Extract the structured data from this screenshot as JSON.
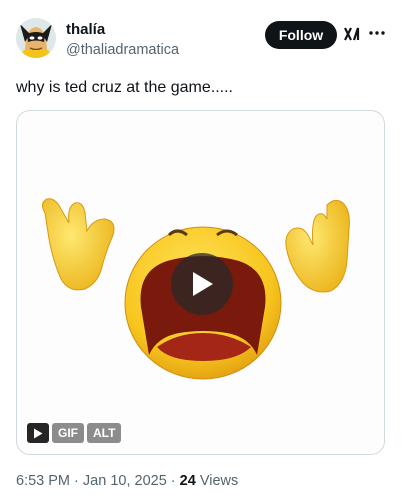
{
  "user": {
    "display_name": "thalía",
    "handle": "@thaliadramatica",
    "avatar_icon": "wolverine-avatar"
  },
  "header": {
    "follow_label": "Follow",
    "grok_icon": "grok-icon",
    "more_icon": "more-icon"
  },
  "tweet": {
    "text": "why is ted cruz at the game....."
  },
  "media": {
    "type": "gif",
    "badges": {
      "gif": "GIF",
      "alt": "ALT"
    },
    "play_icon": "play-icon"
  },
  "meta": {
    "time": "6:53 PM",
    "separator1": "·",
    "date": "Jan 10, 2025",
    "separator2": "·",
    "views_count": "24",
    "views_label": "Views"
  },
  "colors": {
    "text": "#0f1419",
    "secondary": "#536471",
    "border": "#cfd9de",
    "emoji_yellow": "#f7c51e",
    "mouth": "#7a1a0c"
  }
}
